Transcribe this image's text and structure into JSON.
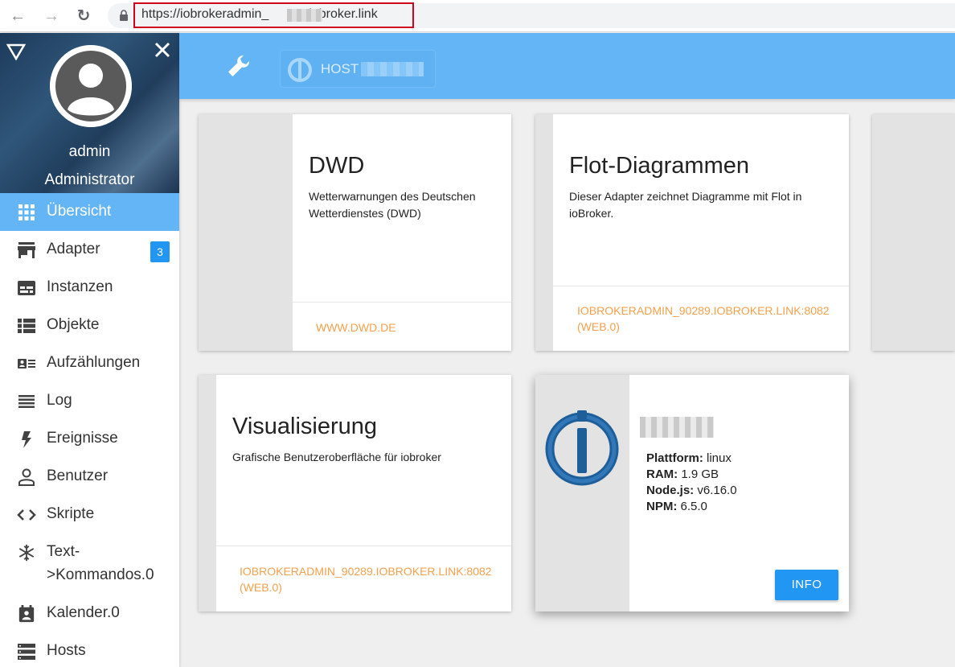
{
  "browser": {
    "url_prefix": "https://iobrokeradmin_",
    "url_suffix": "iobroker.link"
  },
  "sidebar": {
    "user_name": "admin",
    "user_role": "Administrator",
    "items": [
      {
        "label": "Übersicht",
        "icon": "grid-icon",
        "active": true
      },
      {
        "label": "Adapter",
        "icon": "store-icon",
        "badge": "3"
      },
      {
        "label": "Instanzen",
        "icon": "instances-icon"
      },
      {
        "label": "Objekte",
        "icon": "list-icon"
      },
      {
        "label": "Aufzählungen",
        "icon": "enum-icon"
      },
      {
        "label": "Log",
        "icon": "log-icon"
      },
      {
        "label": "Ereignisse",
        "icon": "bolt-icon"
      },
      {
        "label": "Benutzer",
        "icon": "user-icon"
      },
      {
        "label": "Skripte",
        "icon": "code-icon"
      },
      {
        "label": "Text-",
        "label2": ">Kommandos.0",
        "icon": "snowflake-icon"
      },
      {
        "label": "Kalender.0",
        "icon": "calendar-icon"
      },
      {
        "label": "Hosts",
        "icon": "hosts-icon"
      }
    ]
  },
  "header": {
    "host_label": "HOST"
  },
  "cards": {
    "dwd": {
      "title": "DWD",
      "desc_line1": "Wetterwarnungen des Deutschen",
      "desc_line2": "Wetterdienstes (DWD)",
      "link": "WWW.DWD.DE"
    },
    "flot": {
      "title": "Flot-Diagrammen",
      "desc_line1": "Dieser Adapter zeichnet Diagramme mit Flot in",
      "desc_line2": "ioBroker.",
      "link_line1": "IOBROKERADMIN_90289.IOBROKER.LINK:8082",
      "link_line2": "(WEB.0)"
    },
    "vis": {
      "title": "Visualisierung",
      "desc_line1": "Grafische Benutzeroberfläche für iobroker",
      "link_line1": "IOBROKERADMIN_90289.IOBROKER.LINK:8082",
      "link_line2": "(WEB.0)"
    },
    "host": {
      "platform_label": "Plattform:",
      "platform_value": "linux",
      "ram_label": "RAM:",
      "ram_value": "1.9 GB",
      "node_label": "Node.js:",
      "node_value": "v6.16.0",
      "npm_label": "NPM:",
      "npm_value": "6.5.0",
      "info_button": "INFO"
    }
  },
  "colors": {
    "accent": "#64b5f6",
    "primary": "#2196f3",
    "link": "#f5a04d",
    "url_highlight": "#d0021b"
  }
}
